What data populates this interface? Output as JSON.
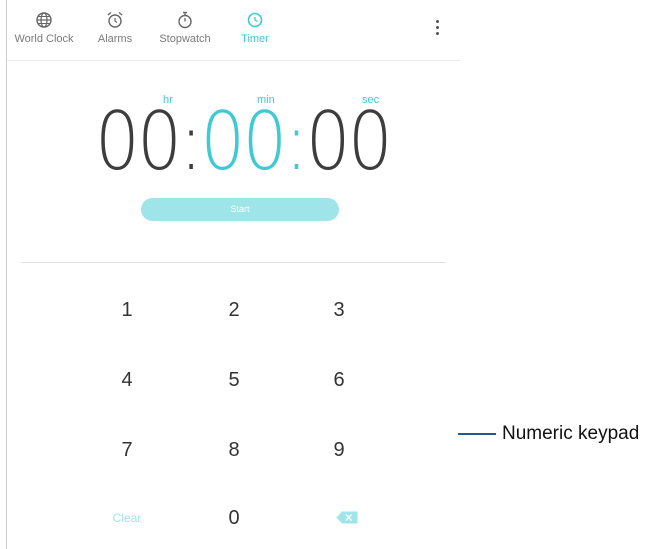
{
  "tabs": [
    {
      "label": "World Clock",
      "icon": "globe-icon"
    },
    {
      "label": "Alarms",
      "icon": "alarm-clock-icon"
    },
    {
      "label": "Stopwatch",
      "icon": "stopwatch-icon"
    },
    {
      "label": "Timer",
      "icon": "timer-icon",
      "active": true
    }
  ],
  "timer": {
    "units": {
      "hr": "hr",
      "min": "min",
      "sec": "sec"
    },
    "hours": "00",
    "minutes": "00",
    "seconds": "00",
    "separator": ":",
    "start_label": "Start"
  },
  "keypad": {
    "keys": [
      "1",
      "2",
      "3",
      "4",
      "5",
      "6",
      "7",
      "8",
      "9"
    ],
    "clear_label": "Clear",
    "zero": "0",
    "backspace_icon": "backspace-icon"
  },
  "annotation": {
    "label": "Numeric keypad"
  },
  "colors": {
    "accent": "#3fc9d3",
    "accent_light": "#9fe4e8",
    "text": "#3d3d3d"
  }
}
